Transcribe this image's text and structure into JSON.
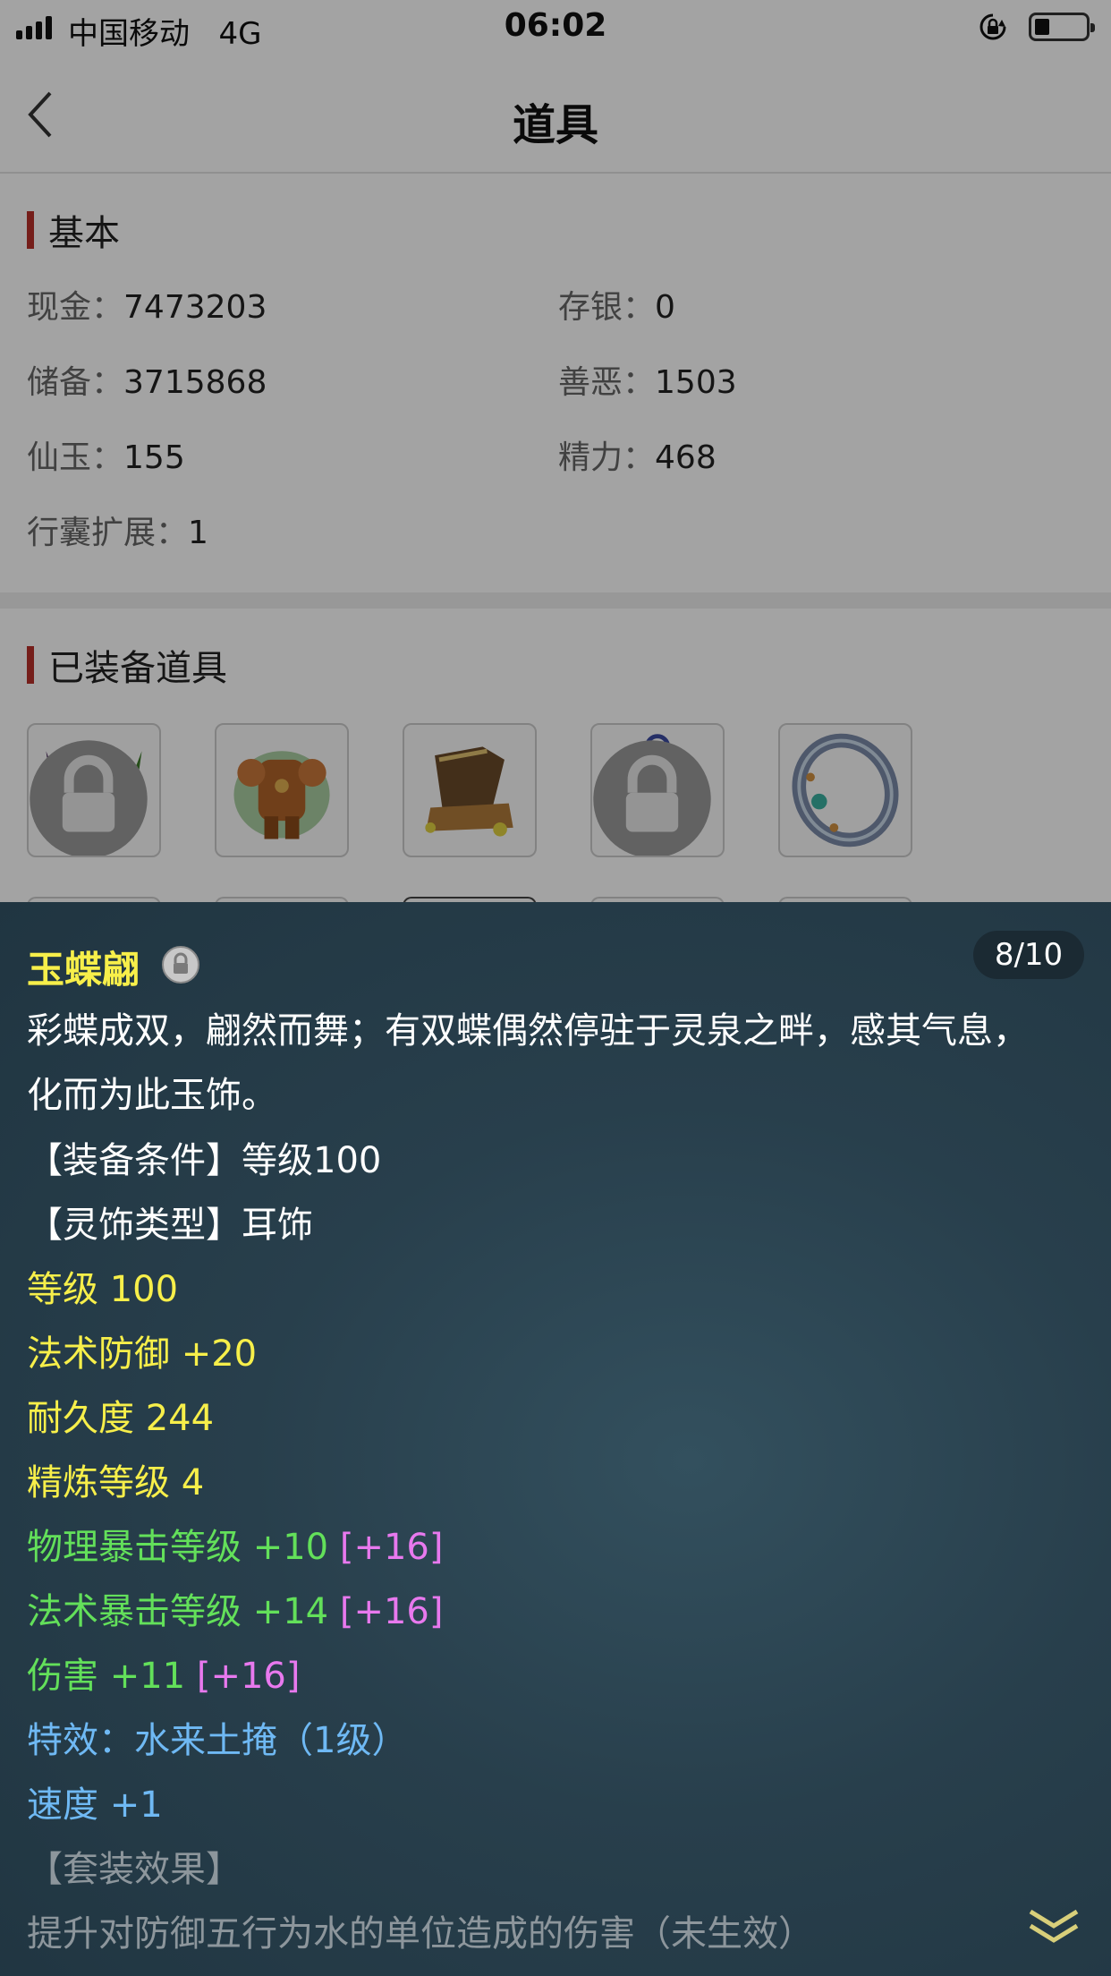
{
  "status_bar": {
    "carrier": "中国移动",
    "network": "4G",
    "time": "06:02"
  },
  "nav": {
    "title": "道具",
    "back_icon": "chevron-left-icon"
  },
  "basic": {
    "title": "基本",
    "fields": [
      {
        "label": "现金：",
        "value": "7473203"
      },
      {
        "label": "存银：",
        "value": "0"
      },
      {
        "label": "储备：",
        "value": "3715868"
      },
      {
        "label": "善恶：",
        "value": "1503"
      },
      {
        "label": "仙玉：",
        "value": "155"
      },
      {
        "label": "精力：",
        "value": "468"
      },
      {
        "label": "行囊扩展：",
        "value": "1"
      }
    ]
  },
  "equipped": {
    "title": "已装备道具",
    "items": [
      {
        "icon": "horned-helmet-icon",
        "locked": true
      },
      {
        "icon": "armor-icon",
        "locked": false
      },
      {
        "icon": "boots-icon",
        "locked": false
      },
      {
        "icon": "pendant-icon",
        "locked": true
      },
      {
        "icon": "ring-icon",
        "locked": false
      }
    ]
  },
  "detail": {
    "name": "玉蝶翩",
    "page": "8/10",
    "description": "彩蝶成双，翩然而舞；有双蝶偶然停驻于灵泉之畔，感其气息，化而为此玉饰。",
    "requirement": "【装备条件】等级100",
    "type": "【灵饰类型】耳饰",
    "level": "等级 100",
    "magic_def": "法术防御 +20",
    "durability": "耐久度 244",
    "refine": "精炼等级 4",
    "phys_crit": {
      "text": "物理暴击等级 +10",
      "bonus": "[+16]"
    },
    "magic_crit": {
      "text": "法术暴击等级 +14",
      "bonus": "[+16]"
    },
    "damage": {
      "text": "伤害 +11",
      "bonus": "[+16]"
    },
    "effect": "特效：水来土掩（1级）",
    "speed": "速度 +1",
    "set_title": "【套装效果】",
    "set_desc": "提升对防御五行为水的单位造成的伤害（未生效）"
  },
  "colors": {
    "accent_red": "#b8302a",
    "panel_bg": "#283f4c",
    "yellow": "#f7ef4a",
    "green": "#63e05a",
    "pink": "#e879ee",
    "blue": "#6fb9f4"
  }
}
